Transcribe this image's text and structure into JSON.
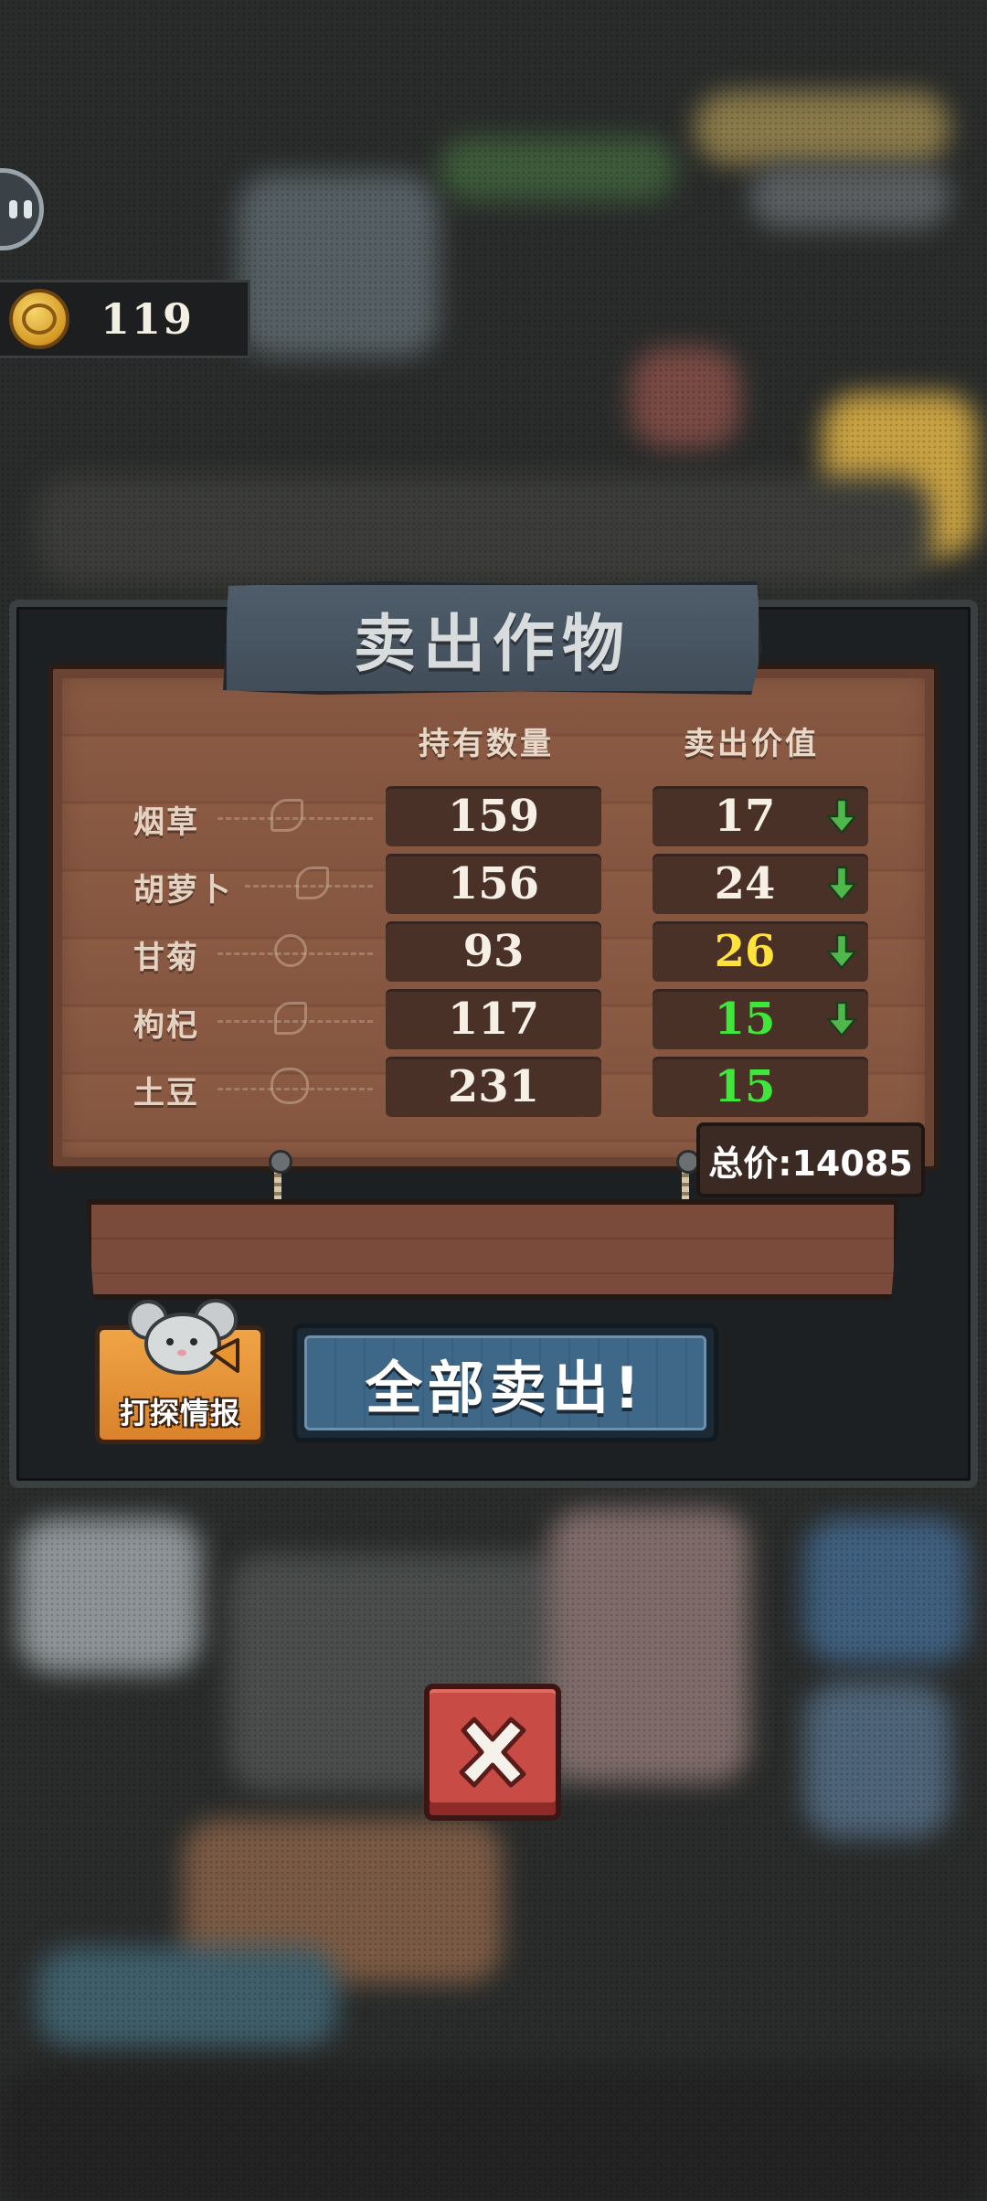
{
  "hud": {
    "coin_count": "119"
  },
  "dialog": {
    "title": "卖出作物",
    "columns": {
      "quantity": "持有数量",
      "price": "卖出价值"
    },
    "rows": [
      {
        "name": "烟草",
        "quantity": "159",
        "price": "17",
        "price_color": "#f5efe6",
        "trend": "down"
      },
      {
        "name": "胡萝卜",
        "quantity": "156",
        "price": "24",
        "price_color": "#f5efe6",
        "trend": "down"
      },
      {
        "name": "甘菊",
        "quantity": "93",
        "price": "26",
        "price_color": "#ffe23a",
        "trend": "down"
      },
      {
        "name": "枸杞",
        "quantity": "117",
        "price": "15",
        "price_color": "#3ee83a",
        "trend": "down"
      },
      {
        "name": "土豆",
        "quantity": "231",
        "price": "15",
        "price_color": "#3ee83a",
        "trend": "none"
      }
    ],
    "total_label": "总价:14085",
    "intel_button_label": "打探情报",
    "sell_all_label": "全部卖出!"
  },
  "colors": {
    "trend_arrow": "#4fb84a",
    "sell_button": "#3f6787",
    "close_button": "#c94b46"
  },
  "icons": {
    "pause": "pause-icon",
    "coin": "coin-icon",
    "trend_down": "arrow-down-icon",
    "close": "close-icon"
  }
}
